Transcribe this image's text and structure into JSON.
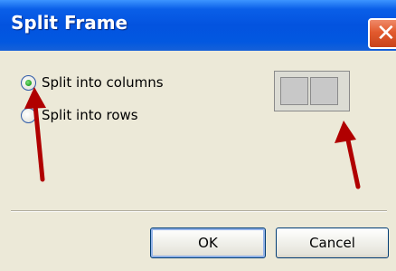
{
  "window": {
    "title": "Split Frame",
    "close_glyph": "✕"
  },
  "options": [
    {
      "label": "Split into columns",
      "selected": true
    },
    {
      "label": "Split into rows",
      "selected": false
    }
  ],
  "buttons": {
    "ok_label": "OK",
    "cancel_label": "Cancel"
  },
  "colors": {
    "arrow": "#cc0000",
    "titlebar": "#0353df",
    "dialog_bg": "#ece9d8"
  }
}
